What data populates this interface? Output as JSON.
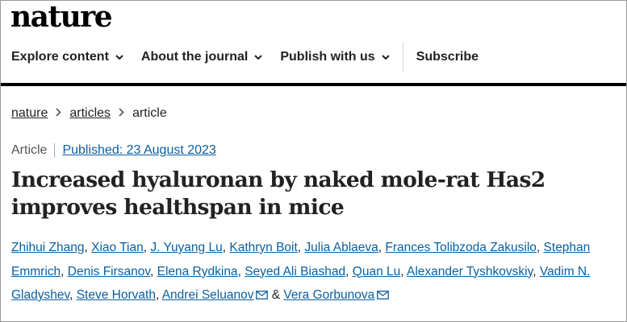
{
  "brand": {
    "logo_text": "nature"
  },
  "nav": {
    "items": [
      {
        "label": "Explore content",
        "icon": "chevron-down-icon"
      },
      {
        "label": "About the journal",
        "icon": "chevron-down-icon"
      },
      {
        "label": "Publish with us",
        "icon": "chevron-down-icon"
      }
    ],
    "subscribe_label": "Subscribe"
  },
  "breadcrumb": {
    "items": [
      "nature",
      "articles"
    ],
    "current": "article",
    "separator_icon": "chevron-right-icon"
  },
  "article": {
    "type": "Article",
    "published": "Published: 23 August 2023",
    "title": "Increased hyaluronan by naked mole-rat Has2 improves healthspan in mice",
    "authors": [
      {
        "name": "Zhihui Zhang"
      },
      {
        "name": "Xiao Tian"
      },
      {
        "name": "J. Yuyang Lu"
      },
      {
        "name": "Kathryn Boit"
      },
      {
        "name": "Julia Ablaeva"
      },
      {
        "name": "Frances Tolibzoda Zakusilo"
      },
      {
        "name": "Stephan Emmrich"
      },
      {
        "name": "Denis Firsanov"
      },
      {
        "name": "Elena Rydkina"
      },
      {
        "name": "Seyed Ali Biashad"
      },
      {
        "name": "Quan Lu"
      },
      {
        "name": "Alexander Tyshkovskiy"
      },
      {
        "name": "Vadim N. Gladyshev"
      },
      {
        "name": "Steve Horvath"
      },
      {
        "name": "Andrei Seluanov",
        "icon": "mail-icon"
      },
      {
        "name": "Vera Gorbunova",
        "icon": "mail-icon"
      }
    ],
    "author_separator": ", ",
    "final_separator": " & "
  },
  "colors": {
    "link": "#0b5fa0",
    "text": "#222222",
    "nav_rule": "#000000"
  }
}
